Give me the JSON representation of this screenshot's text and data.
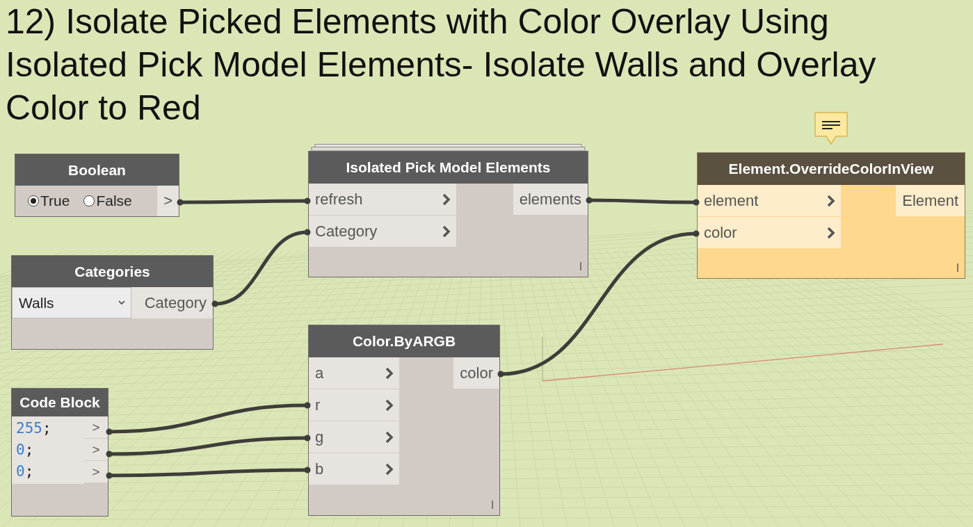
{
  "title": "12) Isolate Picked Elements with Color Overlay Using Isolated Pick Model Elements- Isolate Walls and Overlay Color to Red",
  "nodes": [
    {
      "kind": "boolean",
      "title": "Boolean",
      "selected": false,
      "options": [
        {
          "label": "True",
          "selected": true
        },
        {
          "label": "False",
          "selected": false
        }
      ],
      "outputs": [
        ">"
      ]
    },
    {
      "kind": "dropdown",
      "title": "Categories",
      "selected": false,
      "value": "Walls",
      "outputs": [
        "Category"
      ]
    },
    {
      "kind": "code",
      "title": "Code Block",
      "selected": false,
      "lines": [
        {
          "value": "255",
          "end": ";"
        },
        {
          "value": "0",
          "end": ";"
        },
        {
          "value": "0",
          "end": ";"
        }
      ],
      "outputs": [
        ">",
        ">",
        ">"
      ]
    },
    {
      "kind": "function",
      "title": "Isolated Pick Model Elements",
      "selected": false,
      "note": false,
      "stacked": true,
      "inputs": [
        "refresh",
        "Category"
      ],
      "outputs": [
        "elements"
      ]
    },
    {
      "kind": "function",
      "title": "Color.ByARGB",
      "selected": false,
      "note": false,
      "stacked": false,
      "inputs": [
        "a",
        "r",
        "g",
        "b"
      ],
      "outputs": [
        "color"
      ]
    },
    {
      "kind": "function",
      "title": "Element.OverrideColorInView",
      "selected": true,
      "note": true,
      "stacked": false,
      "inputs": [
        "element",
        "color"
      ],
      "outputs": [
        "Element"
      ]
    }
  ]
}
